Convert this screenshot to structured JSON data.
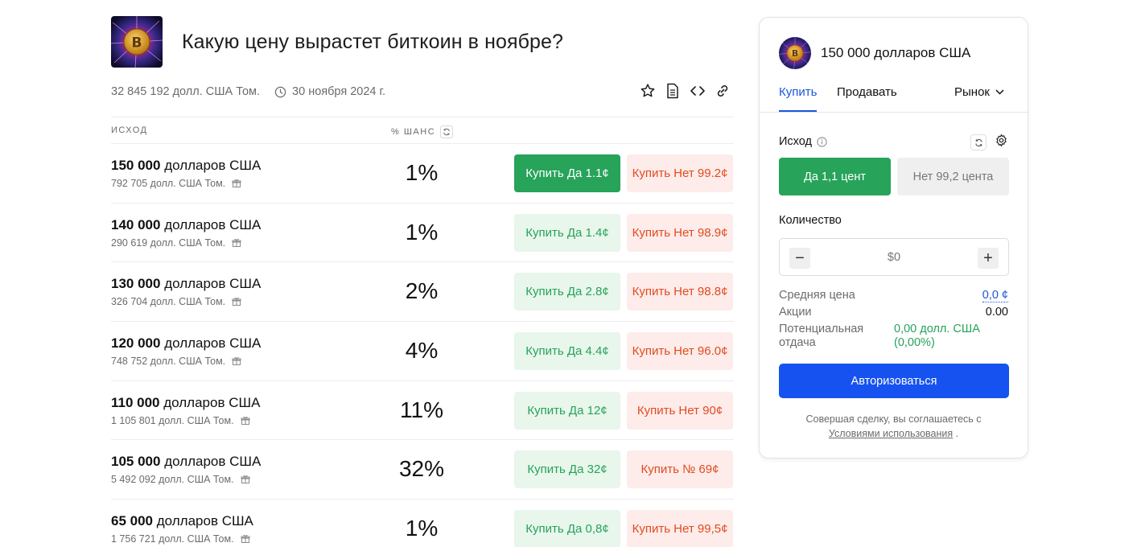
{
  "market": {
    "title": "Какую цену вырастет биткоин в ноябре?",
    "volume": "32 845 192 долл. США Том.",
    "end_date": "30 ноября 2024 г.",
    "icons": [
      "star-icon",
      "document-icon",
      "embed-code-icon",
      "link-icon"
    ]
  },
  "table": {
    "header_outcome": "ИСХОД",
    "header_chance": "% ШАНС",
    "rows": [
      {
        "label": "150 000 долларов США",
        "volume": "792 705 долл. США Том.",
        "chance": "1%",
        "yes": "Купить Да 1.1¢",
        "no": "Купить Нет 99.2¢",
        "selected": true
      },
      {
        "label": "140 000 долларов США",
        "volume": "290 619 долл. США Том.",
        "chance": "1%",
        "yes": "Купить Да 1.4¢",
        "no": "Купить Нет 98.9¢",
        "selected": false
      },
      {
        "label": "130 000 долларов США",
        "volume": "326 704 долл. США Том.",
        "chance": "2%",
        "yes": "Купить Да 2.8¢",
        "no": "Купить Нет 98.8¢",
        "selected": false
      },
      {
        "label": "120 000 долларов США",
        "volume": "748 752 долл. США Том.",
        "chance": "4%",
        "yes": "Купить Да 4.4¢",
        "no": "Купить Нет 96.0¢",
        "selected": false
      },
      {
        "label": "110 000 долларов США",
        "volume": "1 105 801 долл. США Том.",
        "chance": "11%",
        "yes": "Купить Да 12¢",
        "no": "Купить Нет 90¢",
        "selected": false
      },
      {
        "label": "105 000 долларов США",
        "volume": "5 492 092 долл. США Том.",
        "chance": "32%",
        "yes": "Купить Да 32¢",
        "no": "Купить № 69¢",
        "selected": false
      },
      {
        "label": "65 000 долларов США",
        "volume": "1 756 721 долл. США Том.",
        "chance": "1%",
        "yes": "Купить Да 0,8¢",
        "no": "Купить Нет 99,5¢",
        "selected": false
      }
    ]
  },
  "panel": {
    "selected_outcome": "150 000 долларов США",
    "tab_buy": "Купить",
    "tab_sell": "Продавать",
    "order_type": "Рынок",
    "outcome_label": "Исход",
    "yes_choice": "Да 1,1 цент",
    "no_choice": "Нет 99,2 цента",
    "quantity_label": "Количество",
    "quantity_placeholder": "$0",
    "minus": "−",
    "plus": "+",
    "avg_price_label": "Средняя цена",
    "avg_price_value": "0,0 ¢",
    "shares_label": "Акции",
    "shares_value": "0.00",
    "return_label": "Потенциальная отдача",
    "return_value": "0,00 долл. США (0,00%)",
    "login_button": "Авторизоваться",
    "terms_text": "Совершая сделку, вы соглашаетесь с",
    "terms_link": "Условиями использования",
    "terms_end": "."
  },
  "colors": {
    "yes_green": "#27a35a",
    "yes_light": "#e8f6ec",
    "no_red": "#e34a1f",
    "no_light": "#fdecea",
    "accent_blue": "#1652f0"
  }
}
